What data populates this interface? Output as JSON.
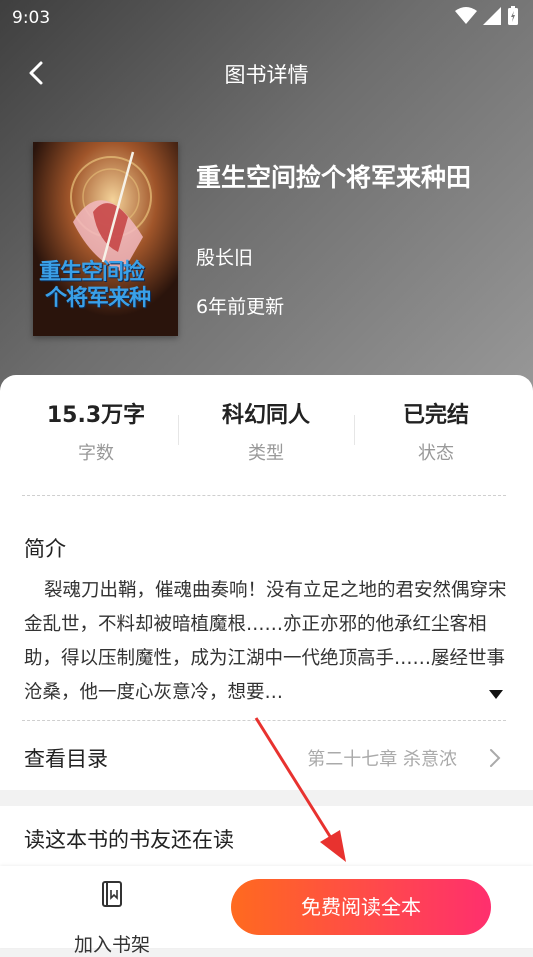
{
  "status_bar": {
    "time": "9:03"
  },
  "nav": {
    "title": "图书详情"
  },
  "book": {
    "title": "重生空间捡个将军来种田",
    "author": "殷长旧",
    "updated": "6年前更新",
    "cover_text_line1": "重生空间捡",
    "cover_text_line2": "个将军来种"
  },
  "stats": [
    {
      "value": "15.3万字",
      "label": "字数"
    },
    {
      "value": "科幻同人",
      "label": "类型"
    },
    {
      "value": "已完结",
      "label": "状态"
    }
  ],
  "intro": {
    "heading": "简介",
    "text": "裂魂刀出鞘，催魂曲奏响！没有立足之地的君安然偶穿宋金乱世，不料却被暗植魔根……亦正亦邪的他承红尘客相助，得以压制魔性，成为江湖中一代绝顶高手……屡经世事沧桑，他一度心灰意冷，想要…"
  },
  "toc": {
    "label": "查看目录",
    "latest_chapter": "第二十七章 杀意浓"
  },
  "friends": {
    "heading": "读这本书的书友还在读"
  },
  "bottom": {
    "shelf_label": "加入书架",
    "read_label": "免费阅读全本"
  },
  "colors": {
    "accent_start": "#ff6a1f",
    "accent_end": "#ff2f6e",
    "annotation_arrow": "#e8322f"
  }
}
